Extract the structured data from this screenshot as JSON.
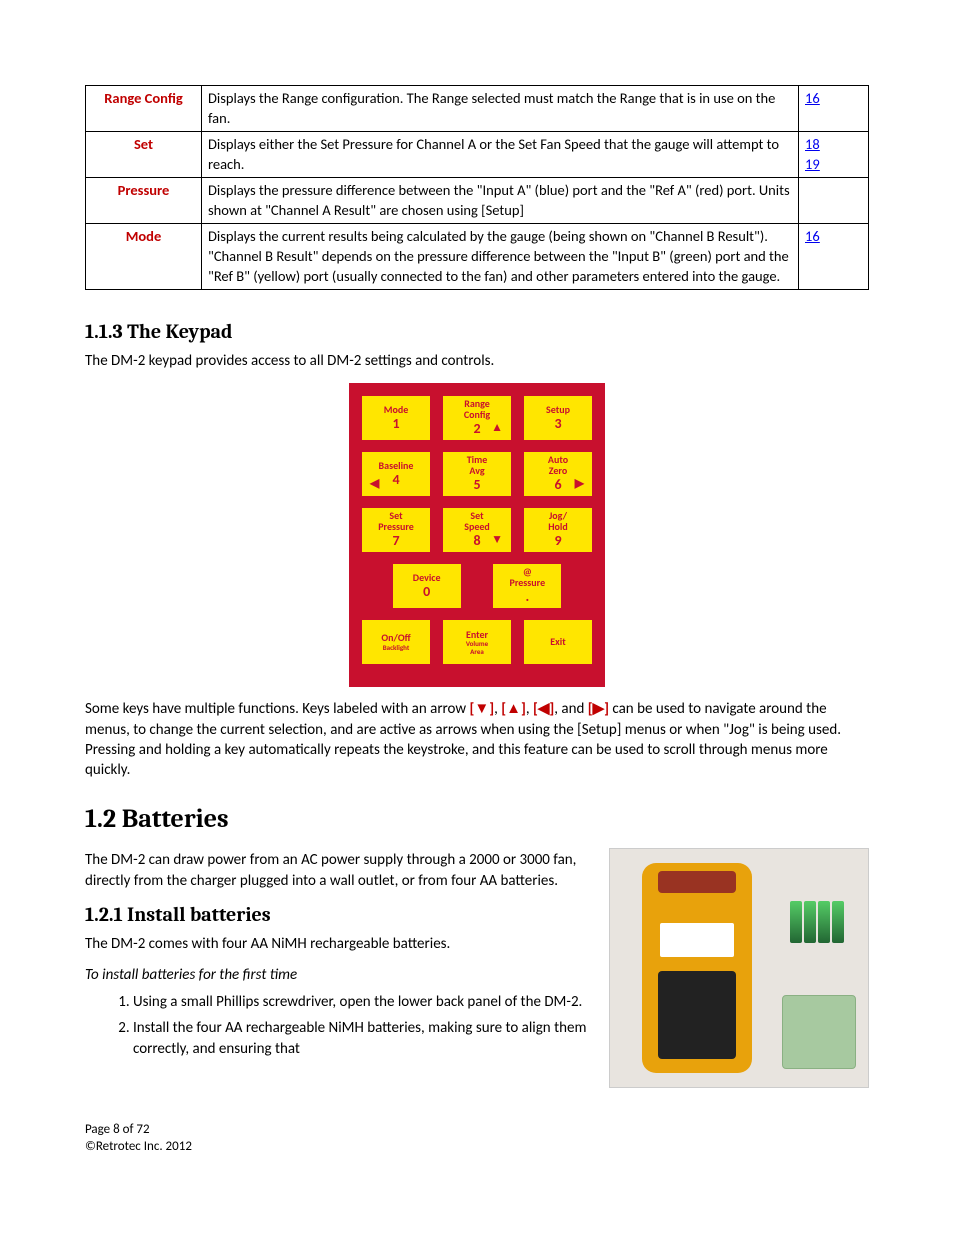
{
  "table": {
    "rows": [
      {
        "label": "Range Config",
        "desc": "Displays the Range configuration.  The Range selected must match the Range that is in use on the fan.",
        "links": [
          "16"
        ]
      },
      {
        "label": "Set",
        "desc": "Displays either the Set Pressure for Channel A or the Set Fan Speed that the gauge will attempt to reach.",
        "links": [
          "18",
          "19"
        ]
      },
      {
        "label": "Pressure",
        "desc": "Displays the pressure difference between the \"Input A\" (blue) port and the \"Ref A\" (red) port.  Units shown at \"Channel A Result\" are chosen using [Setup]",
        "links": []
      },
      {
        "label": "Mode",
        "desc": "Displays the current results being calculated by the gauge (being shown on \"Channel B Result\").  \"Channel B Result\" depends on the pressure difference between the \"Input B\" (green) port and the \"Ref B\" (yellow) port (usually connected to the fan) and other parameters entered into the gauge.",
        "links": [
          "16"
        ]
      }
    ]
  },
  "headings": {
    "keypad": "1.1.3  The Keypad",
    "batteries": "1.2  Batteries",
    "install": "1.2.1  Install batteries"
  },
  "para": {
    "keypad_intro": "The DM-2 keypad provides access to all DM-2 settings and controls.",
    "keypad_after_pre": "Some keys have multiple functions.  Keys labeled with an arrow ",
    "keypad_after_mid": " can be used to navigate around the menus, to change the current selection, and are active as arrows when using the [Setup] menus or when \"Jog\" is being used.  Pressing and holding a key automatically repeats the keystroke, and this feature can be used to scroll through menus more quickly.",
    "batteries_intro": "The DM-2 can draw power from an AC power supply through a 2000 or 3000 fan, directly from the charger plugged into a wall outlet, or from four AA batteries.",
    "install_intro": "The DM-2 comes with four AA NiMH rechargeable batteries.",
    "install_subhead": "To install batteries for the first time"
  },
  "arrows": {
    "down": "[▼]",
    "up": "[▲]",
    "left": "[◀]",
    "right": "[▶]",
    "and": ", and ",
    "sep": ", "
  },
  "steps": [
    "Using a small Phillips screwdriver, open the lower back panel of the DM-2.",
    "Install the four AA rechargeable NiMH batteries, making sure to align them correctly, and ensuring that"
  ],
  "keypad": {
    "r1": [
      {
        "top": "Mode",
        "num": "1",
        "arrow": ""
      },
      {
        "top": "Range Config",
        "num": "2",
        "arrow": "▲"
      },
      {
        "top": "Setup",
        "num": "3",
        "arrow": ""
      }
    ],
    "r2": [
      {
        "top": "Baseline",
        "num": "4",
        "arrow": "◀"
      },
      {
        "top": "Time Avg",
        "num": "5",
        "arrow": ""
      },
      {
        "top": "Auto Zero",
        "num": "6",
        "arrow": "▶"
      }
    ],
    "r3": [
      {
        "top": "Set Pressure",
        "num": "7",
        "arrow": ""
      },
      {
        "top": "Set Speed",
        "num": "8",
        "arrow": "▼"
      },
      {
        "top": "Jog/ Hold",
        "num": "9",
        "arrow": ""
      }
    ],
    "r4": [
      {
        "top": "Device",
        "num": "0",
        "arrow": ""
      },
      {
        "top": "@ Pressure",
        "num": ".",
        "arrow": ""
      }
    ],
    "r5": [
      {
        "top": "On/Off",
        "sub": "Backlight",
        "num": "",
        "arrow": ""
      },
      {
        "top": "Enter",
        "sub": "Volume Area",
        "num": "",
        "arrow": ""
      },
      {
        "top": "Exit",
        "sub": "",
        "num": "",
        "arrow": ""
      }
    ]
  },
  "footer": {
    "page": "Page 8 of 72",
    "copyright": "©Retrotec Inc. 2012"
  }
}
